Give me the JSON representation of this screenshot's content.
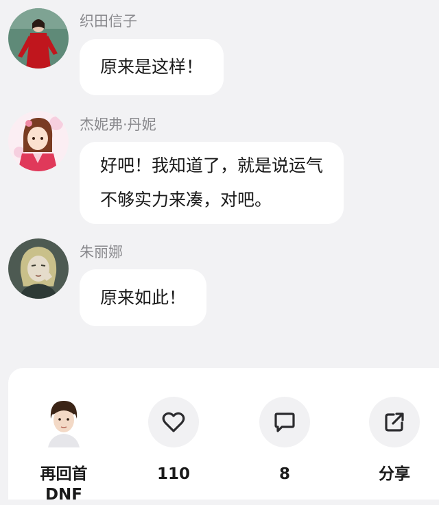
{
  "messages": [
    {
      "sender": "织田信子",
      "lines": [
        "原来是这样！"
      ],
      "avatar": "avatar-woman-red-dress"
    },
    {
      "sender": "杰妮弗·丹妮",
      "lines": [
        "好吧！我知道了，就是说运气",
        "不够实力来凑，对吧。"
      ],
      "avatar": "avatar-anime-girl-kimono"
    },
    {
      "sender": "朱丽娜",
      "lines": [
        "原来如此！"
      ],
      "avatar": "avatar-anime-woman-blonde"
    }
  ],
  "actions": {
    "author": "再回首DNF",
    "likes": "110",
    "comments": "8",
    "share": "分享"
  },
  "colors": {
    "background": "#f2f2f4",
    "bubble": "#ffffff",
    "sender_text": "#8a8a8e",
    "icon_circle": "#f1f1f3"
  }
}
